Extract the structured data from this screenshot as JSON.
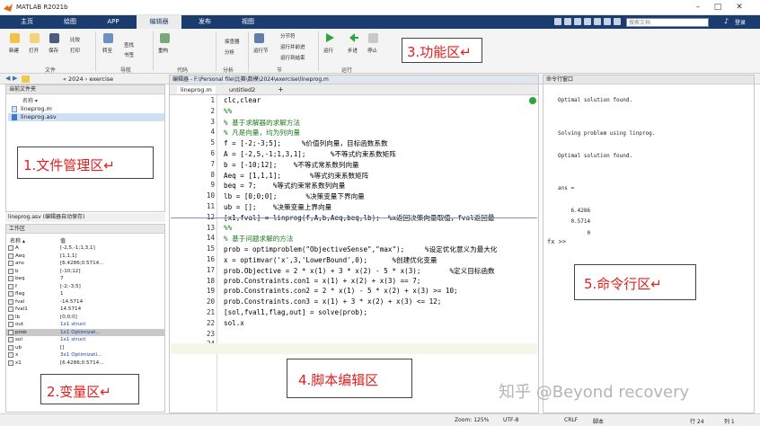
{
  "title": "MATLAB R2021b",
  "tabs": [
    "主页",
    "绘图",
    "APP",
    "编辑器",
    "发布",
    "视图"
  ],
  "search_placeholder": "搜索文档",
  "login_label": "登录",
  "ribbon": {
    "new": "新建",
    "open": "打开",
    "save": "保存",
    "compare": "比较",
    "print": "打印",
    "goto": "转至",
    "find": "查找",
    "bookmark": "书签",
    "refactor": "重构",
    "profiler": "探查器",
    "analyze": "分析",
    "run_section": "运行节",
    "section_break": "分节符",
    "run_advance": "运行并前进",
    "run_to_end": "运行到结束",
    "run": "运行",
    "step": "步进",
    "stop": "停止",
    "groups": [
      "文件",
      "导航",
      "代码",
      "分析",
      "节",
      "运行"
    ]
  },
  "address": {
    "path": "« 2024 › exercise"
  },
  "current_folder": {
    "header": "当前文件夹",
    "col_name": "名称 ▾",
    "files": [
      "lineprog.m",
      "lineprog.asv"
    ]
  },
  "file_details": "lineprog.asv (编辑器自动保存)",
  "workspace": {
    "header": "工作区",
    "col_name": "名称 ▴",
    "col_value": "值",
    "vars": [
      {
        "name": "A",
        "value": "[-2,5,-1;1,3,1]"
      },
      {
        "name": "Aeq",
        "value": "[1,1,1]"
      },
      {
        "name": "ans",
        "value": "[6.4286;0.5714..."
      },
      {
        "name": "b",
        "value": "[-10;12]"
      },
      {
        "name": "beq",
        "value": "7"
      },
      {
        "name": "f",
        "value": "[-2;-3;5]"
      },
      {
        "name": "flag",
        "value": "1"
      },
      {
        "name": "fval",
        "value": "-14.5714"
      },
      {
        "name": "fval1",
        "value": "14.5714"
      },
      {
        "name": "lb",
        "value": "[0;0;0]"
      },
      {
        "name": "out",
        "value": "1x1 struct"
      },
      {
        "name": "prob",
        "value": "1x1 Optimizat..."
      },
      {
        "name": "sol",
        "value": "1x1 struct"
      },
      {
        "name": "ub",
        "value": "[]"
      },
      {
        "name": "x",
        "value": "3x1 Optimizati..."
      },
      {
        "name": "x1",
        "value": "[6.4286;0.5714..."
      }
    ]
  },
  "editor": {
    "header": "编辑器 - F:\\Personal file\\比赛\\数模\\2024\\exercise\\lineprog.m",
    "tabs": [
      "lineprog.m",
      "untitled2"
    ],
    "add_tab": "+",
    "lines": [
      "clc,clear",
      "%%",
      "% 基于求解器的求解方法",
      "% 凡是向量，均为列向量",
      "f = [-2;-3;5];     %价值列向量，目标函数系数",
      "A = [-2,5,-1;1,3,1];      %不等式约束系数矩阵",
      "b = [-10;12];    %不等式常系数列向量",
      "Aeq = [1,1,1];       %等式约束系数矩阵",
      "beq = 7;    %等式约束常系数列向量",
      "lb = [0;0;0];       %决策变量下界向量",
      "ub = [];    %决策变量上界向量",
      "[x1,fval] = linprog(f,A,b,Aeq,beq,lb);  %x返回决策向量取值，fval返回最",
      "%%",
      "% 基于问题求解的方法",
      "prob = optimproblem(\"ObjectiveSense\",\"max\");     %设定优化意义为最大化",
      "x = optimvar('x',3,'LowerBound',0);      %创建优化变量",
      "prob.Objective = 2 * x(1) + 3 * x(2) - 5 * x(3);       %定义目标函数",
      "prob.Constraints.con1 = x(1) + x(2) + x(3) == 7;",
      "prob.Constraints.con2 = 2 * x(1) - 5 * x(2) + x(3) >= 10;",
      "prob.Constraints.con3 = x(1) + 3 * x(2) + x(3) <= 12;",
      "[sol,fval1,flag,out] = solve(prob);",
      "sol.x",
      "",
      ""
    ]
  },
  "command_window": {
    "header": "命令行窗口",
    "lines": [
      "Optimal solution found.",
      "",
      "",
      "Solving problem using linprog.",
      "",
      "Optimal solution found.",
      "",
      "",
      "ans =",
      "",
      "    6.4286",
      "    0.5714",
      "         0"
    ],
    "prompt": "fx >>"
  },
  "annotations": {
    "file_area": "1.文件管理区↵",
    "var_area": "2.变量区↵",
    "func_area": "3.功能区↵",
    "script_area": "4.脚本编辑区",
    "cmd_area": "5.命令行区↵"
  },
  "status": {
    "zoom": "Zoom: 125%",
    "encoding": "UTF-8",
    "eol": "CRLF",
    "type": "脚本",
    "row": "行 24",
    "col": "列 1"
  },
  "watermark": "知乎 @Beyond recovery",
  "colors": {
    "accent": "#1a3c6e",
    "comment": "#1c7a1c",
    "label": "#e02020"
  }
}
